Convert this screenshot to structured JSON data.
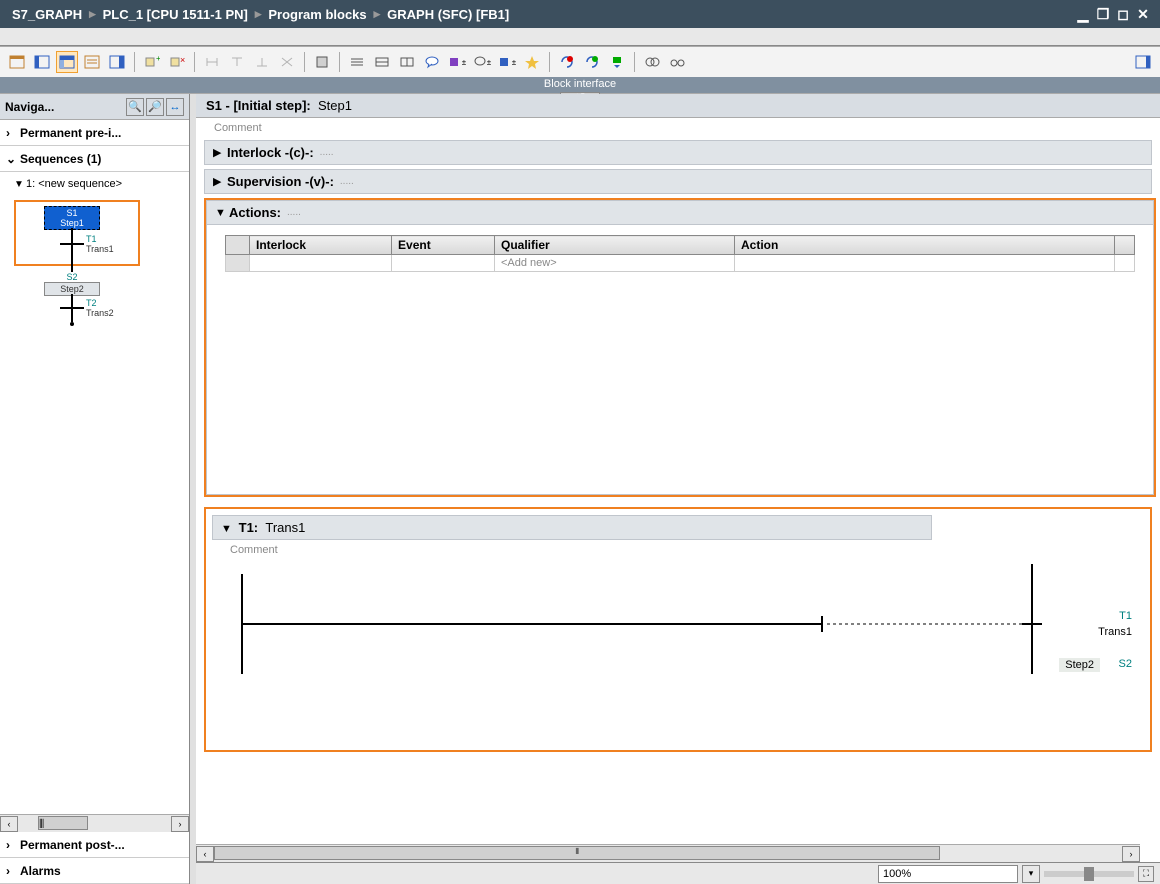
{
  "breadcrumb": [
    "S7_GRAPH",
    "PLC_1 [CPU 1511-1 PN]",
    "Program blocks",
    "GRAPH (SFC) [FB1]"
  ],
  "block_interface_label": "Block interface",
  "nav": {
    "title": "Naviga...",
    "rows": {
      "pre": "Permanent pre-i...",
      "sequences": "Sequences (1)",
      "seq1": "1: <new sequence>",
      "post": "Permanent post-...",
      "alarms": "Alarms"
    },
    "sfc": {
      "s1_id": "S1",
      "s1_name": "Step1",
      "t1_id": "T1",
      "t1_name": "Trans1",
      "s2_id": "S2",
      "s2_name": "Step2",
      "t2_id": "T2",
      "t2_name": "Trans2"
    }
  },
  "editor": {
    "step_header_prefix": "S1 - [Initial step]:",
    "step_name": "Step1",
    "comment": "Comment",
    "interlock": "Interlock -(c)-:",
    "supervision": "Supervision -(v)-:",
    "actions": "Actions:",
    "table": {
      "h_interlock": "Interlock",
      "h_event": "Event",
      "h_qualifier": "Qualifier",
      "h_action": "Action",
      "add_new": "<Add new>"
    },
    "trans": {
      "label": "T1:",
      "name": "Trans1",
      "comment": "Comment",
      "t1": "T1",
      "t1name": "Trans1",
      "s2": "S2",
      "s2name": "Step2"
    }
  },
  "zoom": "100%"
}
